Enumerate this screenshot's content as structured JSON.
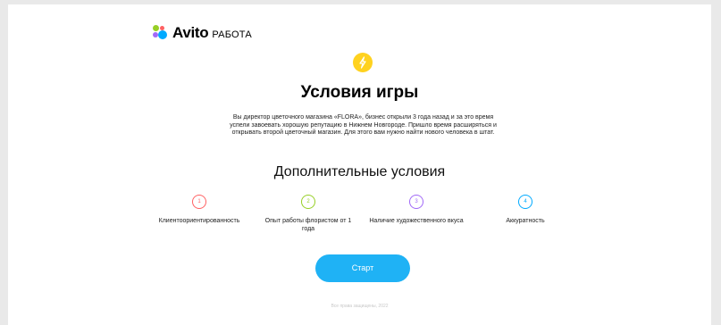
{
  "header": {
    "logo_word": "Avito",
    "logo_sub": "РАБОТА"
  },
  "main": {
    "title": "Условия игры",
    "description": "Вы директор цветочного магазина «FLORA», бизнес открыли 3 года назад и за это время успели завоевать хорошую репутацию в Нижнем Новгороде. Пришло время расширяться и открывать второй цветочный магазин. Для этого вам нужно найти нового человека в штат.",
    "subtitle": "Дополнительные условия",
    "conditions": [
      {
        "num": "1",
        "label": "Клиентоориентированность",
        "color": "#ff6163"
      },
      {
        "num": "2",
        "label": "Опыт работы флористом от 1 года",
        "color": "#97cf26"
      },
      {
        "num": "3",
        "label": "Наличие художественного вкуса",
        "color": "#a169f7"
      },
      {
        "num": "4",
        "label": "Аккуратность",
        "color": "#00aaff"
      }
    ],
    "start_label": "Старт"
  },
  "footer": {
    "text": "Все права защищены, 2022"
  },
  "colors": {
    "accent": "#1fb2f5",
    "bolt": "#ffd21f"
  },
  "icons": {
    "bolt": "lightning-icon"
  }
}
